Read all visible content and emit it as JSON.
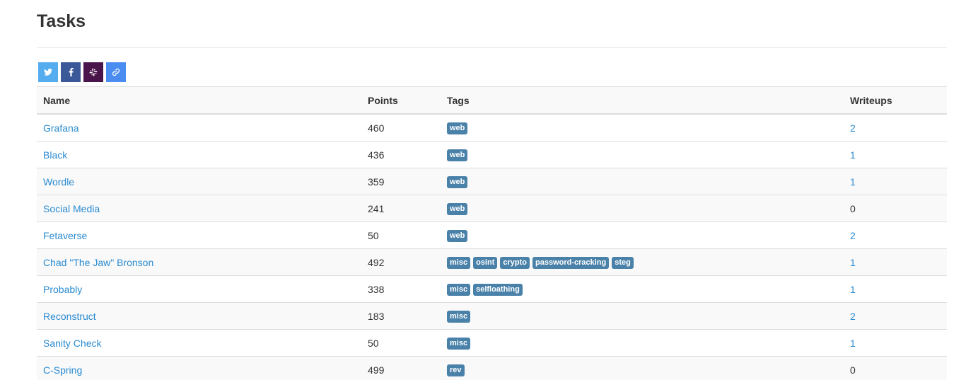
{
  "page": {
    "title": "Tasks"
  },
  "share": {
    "buttons": [
      {
        "icon": "twitter-icon",
        "color": "#55acee"
      },
      {
        "icon": "facebook-icon",
        "color": "#3b5998"
      },
      {
        "icon": "slack-icon",
        "color": "#4a154b"
      },
      {
        "icon": "link-icon",
        "color": "#4a8cf0"
      }
    ]
  },
  "table": {
    "headers": {
      "name": "Name",
      "points": "Points",
      "tags": "Tags",
      "writeups": "Writeups"
    },
    "rows": [
      {
        "name": "Grafana",
        "points": "460",
        "tags": [
          "web"
        ],
        "writeups": "2",
        "writeups_link": true
      },
      {
        "name": "Black",
        "points": "436",
        "tags": [
          "web"
        ],
        "writeups": "1",
        "writeups_link": true
      },
      {
        "name": "Wordle",
        "points": "359",
        "tags": [
          "web"
        ],
        "writeups": "1",
        "writeups_link": true
      },
      {
        "name": "Social Media",
        "points": "241",
        "tags": [
          "web"
        ],
        "writeups": "0",
        "writeups_link": false
      },
      {
        "name": "Fetaverse",
        "points": "50",
        "tags": [
          "web"
        ],
        "writeups": "2",
        "writeups_link": true
      },
      {
        "name": "Chad \"The Jaw\" Bronson",
        "points": "492",
        "tags": [
          "misc",
          "osint",
          "crypto",
          "password-cracking",
          "steg"
        ],
        "writeups": "1",
        "writeups_link": true
      },
      {
        "name": "Probably",
        "points": "338",
        "tags": [
          "misc",
          "selfloathing"
        ],
        "writeups": "1",
        "writeups_link": true
      },
      {
        "name": "Reconstruct",
        "points": "183",
        "tags": [
          "misc"
        ],
        "writeups": "2",
        "writeups_link": true
      },
      {
        "name": "Sanity Check",
        "points": "50",
        "tags": [
          "misc"
        ],
        "writeups": "1",
        "writeups_link": true
      },
      {
        "name": "C-Spring",
        "points": "499",
        "tags": [
          "rev"
        ],
        "writeups": "0",
        "writeups_link": false
      }
    ]
  },
  "colors": {
    "link": "#2a8bd0",
    "tag_bg": "#4a81a9"
  }
}
